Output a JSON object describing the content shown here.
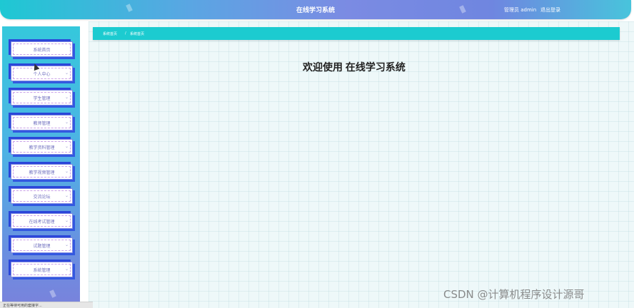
{
  "header": {
    "title": "在线学习系统",
    "user": "管理员 admin",
    "logout": "退出登录"
  },
  "sidebar": {
    "items": [
      {
        "label": "系统首页",
        "chevron": ""
      },
      {
        "label": "个人中心",
        "chevron": "⌄"
      },
      {
        "label": "学生管理",
        "chevron": "⌄"
      },
      {
        "label": "教师管理",
        "chevron": "⌄"
      },
      {
        "label": "教学资料管理",
        "chevron": "⌄"
      },
      {
        "label": "教学视频管理",
        "chevron": "⌄"
      },
      {
        "label": "交流论坛",
        "chevron": "⌄"
      },
      {
        "label": "在线考试管理",
        "chevron": "⌄"
      },
      {
        "label": "试题管理",
        "chevron": "⌄"
      },
      {
        "label": "系统管理",
        "chevron": "⌄"
      }
    ]
  },
  "breadcrumb": {
    "home": "系统首页",
    "separator": "/",
    "current": "系统首页"
  },
  "main": {
    "welcome": "欢迎使用 在线学习系统"
  },
  "watermark": "CSDN @计算机程序设计源哥",
  "statusbar": "正在等待可用的套接字..."
}
